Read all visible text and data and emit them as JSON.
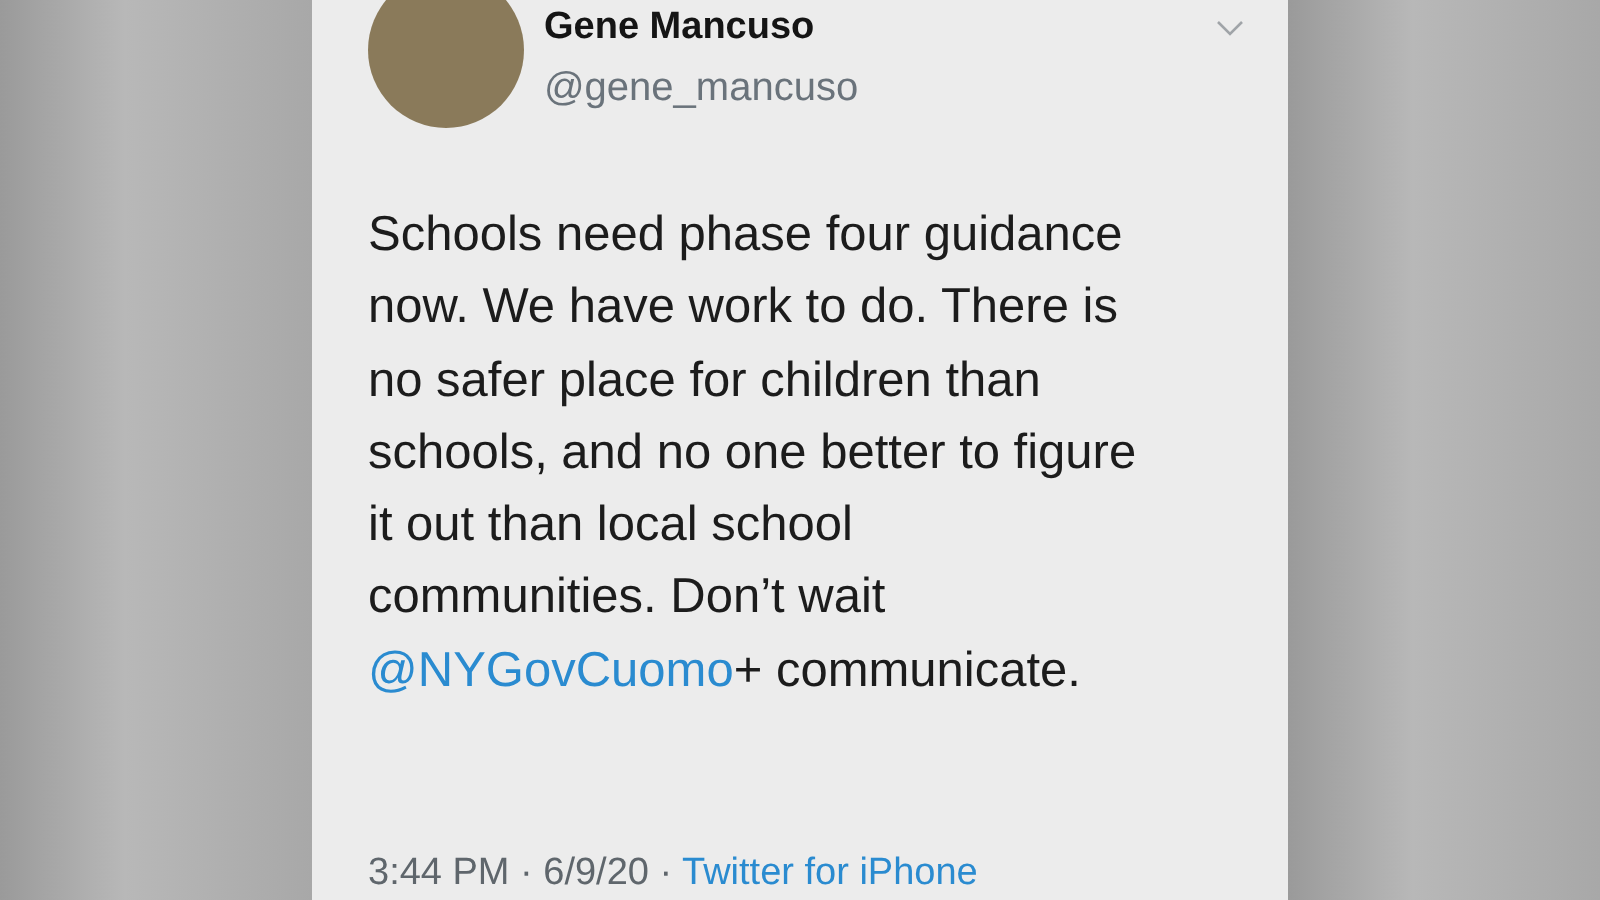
{
  "tweet": {
    "author": {
      "name": "Gene Mancuso",
      "handle": "@gene_mancuso"
    },
    "text": "Schools need phase four guidance now. We have work to do. There is no safer place for children than schools, and no one better to figure it out than local school communities. Don’t wait ",
    "mention": "@NYGovCuomo",
    "text_after": "+ communicate.",
    "time": "3:44 PM · 6/9/20 · ",
    "source": "Twitter for iPhone"
  }
}
